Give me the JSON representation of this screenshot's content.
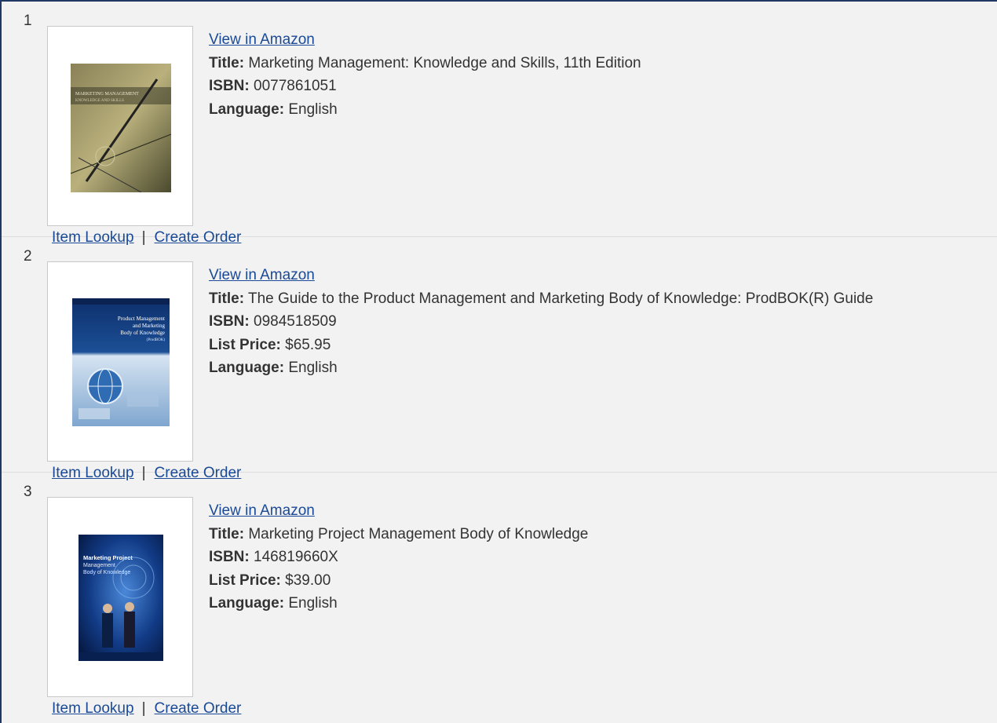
{
  "results": [
    {
      "number": "1",
      "view_link": "View in Amazon",
      "title_label": "Title:",
      "title": "Marketing Management: Knowledge and Skills, 11th Edition",
      "isbn_label": "ISBN:",
      "isbn": "0077861051",
      "language_label": "Language:",
      "language": "English",
      "cover_image": "book-cover-marketing-management",
      "cover_text": "MARKETING MANAGEMENT\nKNOWLEDGE AND SKILLS",
      "item_lookup": "Item Lookup",
      "separator": "|",
      "create_order": "Create Order"
    },
    {
      "number": "2",
      "view_link": "View in Amazon",
      "title_label": "Title:",
      "title": "The Guide to the Product Management and Marketing Body of Knowledge: ProdBOK(R) Guide",
      "isbn_label": "ISBN:",
      "isbn": "0984518509",
      "price_label": "List Price:",
      "price": "$65.95",
      "language_label": "Language:",
      "language": "English",
      "cover_image": "book-cover-prodbok-guide",
      "cover_text": "Product Management\nand Marketing\nBody of Knowledge\n(ProdBOK)",
      "item_lookup": "Item Lookup",
      "separator": "|",
      "create_order": "Create Order"
    },
    {
      "number": "3",
      "view_link": "View in Amazon",
      "title_label": "Title:",
      "title": "Marketing Project Management Body of Knowledge",
      "isbn_label": "ISBN:",
      "isbn": "146819660X",
      "price_label": "List Price:",
      "price": "$39.00",
      "language_label": "Language:",
      "language": "English",
      "cover_image": "book-cover-marketing-project-management",
      "cover_text": "Marketing Project\nManagement\nBody of Knowledge",
      "item_lookup": "Item Lookup",
      "separator": "|",
      "create_order": "Create Order"
    }
  ],
  "colors": {
    "link": "#1a4a96",
    "row_background": "#f2f2f2",
    "frame_border": "#1f3864"
  }
}
